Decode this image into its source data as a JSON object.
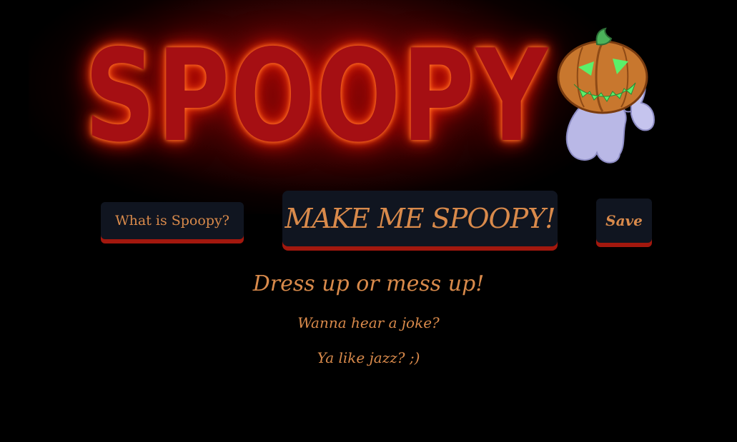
{
  "header": {
    "title": "SPOOPY"
  },
  "mascot": {
    "icon": "jack-o-lantern-ghost-icon"
  },
  "buttons": {
    "what_label": "What is Spoopy?",
    "make_label": "MAKE ME SPOOPY!",
    "save_label": "Save"
  },
  "content": {
    "heading": "Dress up or mess up!",
    "joke_question": "Wanna hear a joke?",
    "joke_answer": "Ya like jazz? ;)"
  },
  "colors": {
    "background": "#000000",
    "title_red": "#a50f13",
    "glow": "#ff5a10",
    "text_orange": "#d98a4b",
    "button_bg": "#101520",
    "button_shadow": "#a3180e"
  }
}
